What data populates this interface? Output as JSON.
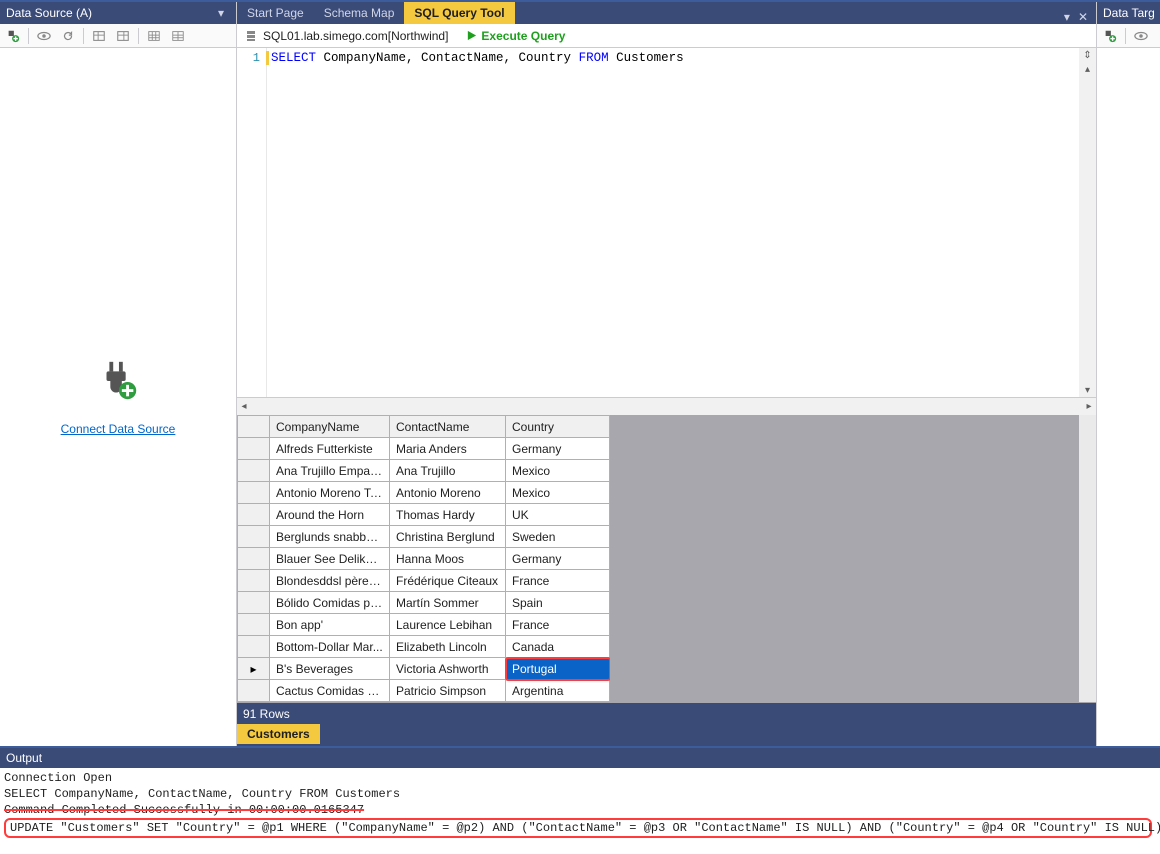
{
  "panels": {
    "left_title": "Data Source (A)",
    "right_title": "Data Target",
    "connect_link": "Connect Data Source"
  },
  "tabs": {
    "items": [
      "Start Page",
      "Schema Map",
      "SQL Query Tool"
    ],
    "active_index": 2,
    "bottom_tab": "Customers"
  },
  "query_toolbar": {
    "connection": "SQL01.lab.simego.com[Northwind]",
    "execute_label": "Execute Query"
  },
  "editor": {
    "line_number": "1",
    "tokens": {
      "select": "SELECT",
      "cols": " CompanyName, ContactName, Country ",
      "from": "FROM",
      "table": " Customers"
    }
  },
  "grid": {
    "columns": [
      "CompanyName",
      "ContactName",
      "Country"
    ],
    "rows": [
      {
        "company": "Alfreds Futterkiste",
        "contact": "Maria Anders",
        "country": "Germany"
      },
      {
        "company": "Ana Trujillo Empare...",
        "contact": "Ana Trujillo",
        "country": "Mexico"
      },
      {
        "company": "Antonio Moreno Ta...",
        "contact": "Antonio Moreno",
        "country": "Mexico"
      },
      {
        "company": "Around the Horn",
        "contact": "Thomas Hardy",
        "country": "UK"
      },
      {
        "company": "Berglunds snabbköp",
        "contact": "Christina Berglund",
        "country": "Sweden"
      },
      {
        "company": "Blauer See Delikate...",
        "contact": "Hanna Moos",
        "country": "Germany"
      },
      {
        "company": "Blondesddsl père et...",
        "contact": "Frédérique Citeaux",
        "country": "France"
      },
      {
        "company": "Bólido Comidas pr...",
        "contact": "Martín Sommer",
        "country": "Spain"
      },
      {
        "company": "Bon app'",
        "contact": "Laurence Lebihan",
        "country": "France"
      },
      {
        "company": "Bottom-Dollar Mar...",
        "contact": "Elizabeth Lincoln",
        "country": "Canada"
      },
      {
        "company": "B's Beverages",
        "contact": "Victoria Ashworth",
        "country": "Portugal"
      },
      {
        "company": "Cactus Comidas pa...",
        "contact": "Patricio Simpson",
        "country": "Argentina"
      }
    ],
    "selected_row_index": 10,
    "selected_col_index": 2,
    "status": "91 Rows"
  },
  "output": {
    "title": "Output",
    "lines": [
      "Connection Open",
      "SELECT CompanyName, ContactName, Country FROM Customers",
      "Command Completed Successfully in 00:00:00.0165347",
      "UPDATE \"Customers\" SET \"Country\" = @p1 WHERE (\"CompanyName\" = @p2) AND (\"ContactName\" = @p3 OR \"ContactName\" IS NULL) AND (\"Country\" = @p4 OR \"Country\" IS NULL)"
    ],
    "struck_index": 2,
    "boxed_index": 3
  }
}
